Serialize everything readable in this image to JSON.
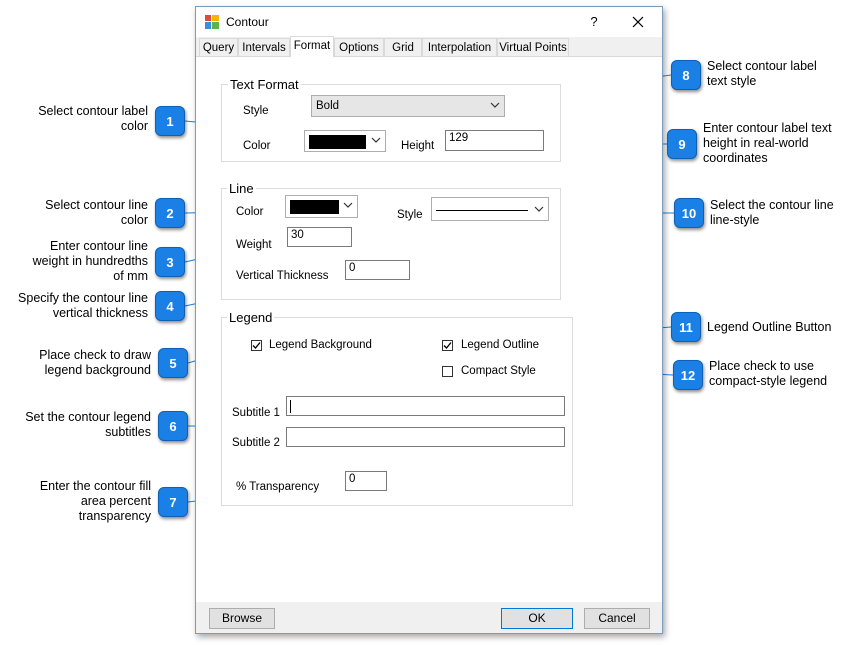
{
  "window": {
    "title": "Contour",
    "help": "?"
  },
  "tabs": [
    "Query",
    "Intervals",
    "Format",
    "Options",
    "Grid",
    "Interpolation",
    "Virtual Points"
  ],
  "text_format": {
    "title": "Text Format",
    "style_label": "Style",
    "style_value": "Bold",
    "color_label": "Color",
    "color_value": "#000000",
    "height_label": "Height",
    "height_value": "129"
  },
  "line": {
    "title": "Line",
    "color_label": "Color",
    "color_value": "#000000",
    "style_label": "Style",
    "weight_label": "Weight",
    "weight_value": "30",
    "vthick_label": "Vertical Thickness",
    "vthick_value": "0"
  },
  "legend": {
    "title": "Legend",
    "background_label": "Legend Background",
    "background_checked": true,
    "outline_label": "Legend Outline",
    "outline_checked": true,
    "compact_label": "Compact Style",
    "compact_checked": false,
    "subtitle1_label": "Subtitle 1",
    "subtitle1_value": "",
    "subtitle2_label": "Subtitle 2",
    "subtitle2_value": "",
    "transparency_label": "% Transparency",
    "transparency_value": "0"
  },
  "buttons": {
    "browse": "Browse",
    "ok": "OK",
    "cancel": "Cancel"
  },
  "callouts": [
    {
      "num": "1",
      "text": "Select contour label color"
    },
    {
      "num": "2",
      "text": "Select contour line color"
    },
    {
      "num": "3",
      "text": "Enter contour line weight in hundredths of mm"
    },
    {
      "num": "4",
      "text": "Specify the contour line vertical thickness"
    },
    {
      "num": "5",
      "text": "Place check to draw legend background"
    },
    {
      "num": "6",
      "text": "Set the contour legend subtitles"
    },
    {
      "num": "7",
      "text": "Enter the contour fill area percent transparency"
    },
    {
      "num": "8",
      "text": "Select contour label text style"
    },
    {
      "num": "9",
      "text": "Enter contour label text height in real-world coordinates"
    },
    {
      "num": "10",
      "text": "Select the contour line line-style"
    },
    {
      "num": "11",
      "text": "Legend Outline Button"
    },
    {
      "num": "12",
      "text": "Place check to use compact-style legend"
    }
  ],
  "accent_color": "#1a80e6"
}
